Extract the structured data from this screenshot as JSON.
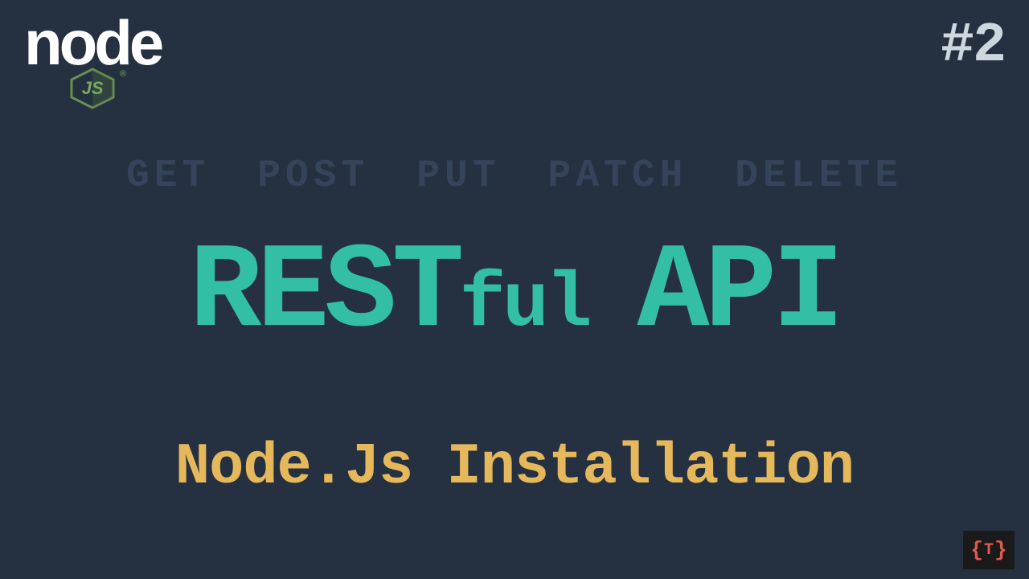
{
  "logo": {
    "word": "node",
    "js": "JS",
    "registered": "®"
  },
  "episode": "#2",
  "http_verbs": "GET POST PUT PATCH DELETE",
  "title": {
    "rest": "REST",
    "ful": "ful",
    "api": "API"
  },
  "subtitle": "Node.Js Installation",
  "badge": {
    "left": "{",
    "mid": "T",
    "right": "}"
  }
}
